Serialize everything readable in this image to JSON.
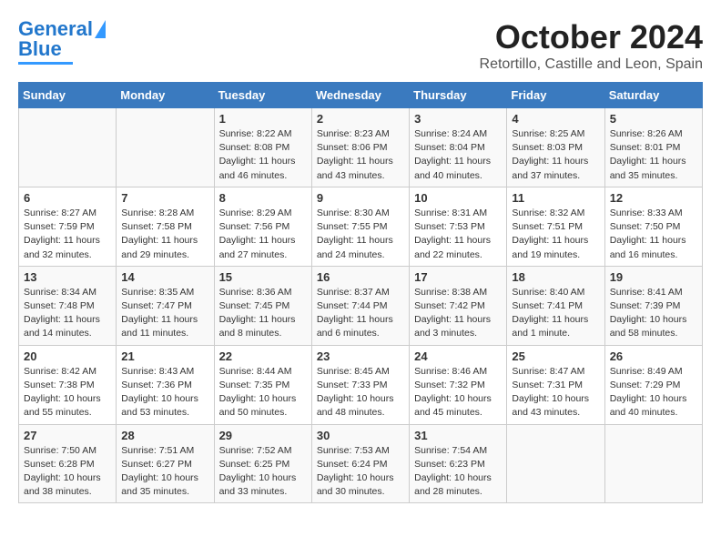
{
  "header": {
    "logo_line1": "General",
    "logo_line2": "Blue",
    "month": "October 2024",
    "location": "Retortillo, Castille and Leon, Spain"
  },
  "weekdays": [
    "Sunday",
    "Monday",
    "Tuesday",
    "Wednesday",
    "Thursday",
    "Friday",
    "Saturday"
  ],
  "weeks": [
    [
      {
        "day": "",
        "info": ""
      },
      {
        "day": "",
        "info": ""
      },
      {
        "day": "1",
        "info": "Sunrise: 8:22 AM\nSunset: 8:08 PM\nDaylight: 11 hours and 46 minutes."
      },
      {
        "day": "2",
        "info": "Sunrise: 8:23 AM\nSunset: 8:06 PM\nDaylight: 11 hours and 43 minutes."
      },
      {
        "day": "3",
        "info": "Sunrise: 8:24 AM\nSunset: 8:04 PM\nDaylight: 11 hours and 40 minutes."
      },
      {
        "day": "4",
        "info": "Sunrise: 8:25 AM\nSunset: 8:03 PM\nDaylight: 11 hours and 37 minutes."
      },
      {
        "day": "5",
        "info": "Sunrise: 8:26 AM\nSunset: 8:01 PM\nDaylight: 11 hours and 35 minutes."
      }
    ],
    [
      {
        "day": "6",
        "info": "Sunrise: 8:27 AM\nSunset: 7:59 PM\nDaylight: 11 hours and 32 minutes."
      },
      {
        "day": "7",
        "info": "Sunrise: 8:28 AM\nSunset: 7:58 PM\nDaylight: 11 hours and 29 minutes."
      },
      {
        "day": "8",
        "info": "Sunrise: 8:29 AM\nSunset: 7:56 PM\nDaylight: 11 hours and 27 minutes."
      },
      {
        "day": "9",
        "info": "Sunrise: 8:30 AM\nSunset: 7:55 PM\nDaylight: 11 hours and 24 minutes."
      },
      {
        "day": "10",
        "info": "Sunrise: 8:31 AM\nSunset: 7:53 PM\nDaylight: 11 hours and 22 minutes."
      },
      {
        "day": "11",
        "info": "Sunrise: 8:32 AM\nSunset: 7:51 PM\nDaylight: 11 hours and 19 minutes."
      },
      {
        "day": "12",
        "info": "Sunrise: 8:33 AM\nSunset: 7:50 PM\nDaylight: 11 hours and 16 minutes."
      }
    ],
    [
      {
        "day": "13",
        "info": "Sunrise: 8:34 AM\nSunset: 7:48 PM\nDaylight: 11 hours and 14 minutes."
      },
      {
        "day": "14",
        "info": "Sunrise: 8:35 AM\nSunset: 7:47 PM\nDaylight: 11 hours and 11 minutes."
      },
      {
        "day": "15",
        "info": "Sunrise: 8:36 AM\nSunset: 7:45 PM\nDaylight: 11 hours and 8 minutes."
      },
      {
        "day": "16",
        "info": "Sunrise: 8:37 AM\nSunset: 7:44 PM\nDaylight: 11 hours and 6 minutes."
      },
      {
        "day": "17",
        "info": "Sunrise: 8:38 AM\nSunset: 7:42 PM\nDaylight: 11 hours and 3 minutes."
      },
      {
        "day": "18",
        "info": "Sunrise: 8:40 AM\nSunset: 7:41 PM\nDaylight: 11 hours and 1 minute."
      },
      {
        "day": "19",
        "info": "Sunrise: 8:41 AM\nSunset: 7:39 PM\nDaylight: 10 hours and 58 minutes."
      }
    ],
    [
      {
        "day": "20",
        "info": "Sunrise: 8:42 AM\nSunset: 7:38 PM\nDaylight: 10 hours and 55 minutes."
      },
      {
        "day": "21",
        "info": "Sunrise: 8:43 AM\nSunset: 7:36 PM\nDaylight: 10 hours and 53 minutes."
      },
      {
        "day": "22",
        "info": "Sunrise: 8:44 AM\nSunset: 7:35 PM\nDaylight: 10 hours and 50 minutes."
      },
      {
        "day": "23",
        "info": "Sunrise: 8:45 AM\nSunset: 7:33 PM\nDaylight: 10 hours and 48 minutes."
      },
      {
        "day": "24",
        "info": "Sunrise: 8:46 AM\nSunset: 7:32 PM\nDaylight: 10 hours and 45 minutes."
      },
      {
        "day": "25",
        "info": "Sunrise: 8:47 AM\nSunset: 7:31 PM\nDaylight: 10 hours and 43 minutes."
      },
      {
        "day": "26",
        "info": "Sunrise: 8:49 AM\nSunset: 7:29 PM\nDaylight: 10 hours and 40 minutes."
      }
    ],
    [
      {
        "day": "27",
        "info": "Sunrise: 7:50 AM\nSunset: 6:28 PM\nDaylight: 10 hours and 38 minutes."
      },
      {
        "day": "28",
        "info": "Sunrise: 7:51 AM\nSunset: 6:27 PM\nDaylight: 10 hours and 35 minutes."
      },
      {
        "day": "29",
        "info": "Sunrise: 7:52 AM\nSunset: 6:25 PM\nDaylight: 10 hours and 33 minutes."
      },
      {
        "day": "30",
        "info": "Sunrise: 7:53 AM\nSunset: 6:24 PM\nDaylight: 10 hours and 30 minutes."
      },
      {
        "day": "31",
        "info": "Sunrise: 7:54 AM\nSunset: 6:23 PM\nDaylight: 10 hours and 28 minutes."
      },
      {
        "day": "",
        "info": ""
      },
      {
        "day": "",
        "info": ""
      }
    ]
  ]
}
